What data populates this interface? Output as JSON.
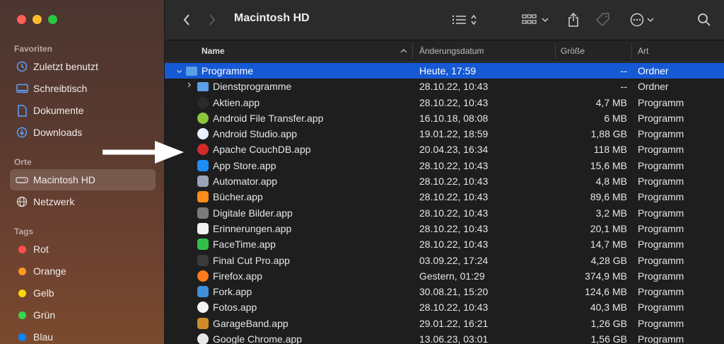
{
  "window": {
    "title": "Macintosh HD"
  },
  "colors": {
    "accent": "#1659d4",
    "sidebar": "#5a3a30"
  },
  "sidebar": {
    "favorites_label": "Favoriten",
    "favorites": [
      {
        "label": "Zuletzt benutzt",
        "icon": "clock-icon"
      },
      {
        "label": "Schreibtisch",
        "icon": "desktop-icon"
      },
      {
        "label": "Dokumente",
        "icon": "document-icon"
      },
      {
        "label": "Downloads",
        "icon": "download-icon"
      }
    ],
    "locations_label": "Orte",
    "locations": [
      {
        "label": "Macintosh HD",
        "icon": "harddisk-icon",
        "selected": true
      },
      {
        "label": "Netzwerk",
        "icon": "globe-icon"
      }
    ],
    "tags_label": "Tags",
    "tags": [
      {
        "label": "Rot",
        "color": "#fe4f4f"
      },
      {
        "label": "Orange",
        "color": "#ff9a1f"
      },
      {
        "label": "Gelb",
        "color": "#ffd60a"
      },
      {
        "label": "Grün",
        "color": "#32d74b"
      },
      {
        "label": "Blau",
        "color": "#0a84ff"
      }
    ]
  },
  "header": {
    "name": "Name",
    "date": "Änderungsdatum",
    "size": "Größe",
    "kind": "Art"
  },
  "rows": [
    {
      "name": "Programme",
      "date": "Heute, 17:59",
      "size": "--",
      "kind": "Ordner",
      "level": 0,
      "disclosure": "open",
      "icon": "folder-icon",
      "color": "#5aa0e6",
      "selected": true
    },
    {
      "name": "Dienstprogramme",
      "date": "28.10.22, 10:43",
      "size": "--",
      "kind": "Ordner",
      "level": 1,
      "disclosure": "closed",
      "icon": "folder-icon",
      "color": "#5aa0e6"
    },
    {
      "name": "Aktien.app",
      "date": "28.10.22, 10:43",
      "size": "4,7 MB",
      "kind": "Programm",
      "level": 1,
      "icon": "stocks-icon",
      "color": "#2b2b2b"
    },
    {
      "name": "Android File Transfer.app",
      "date": "16.10.18, 08:08",
      "size": "6 MB",
      "kind": "Programm",
      "level": 1,
      "icon": "android-icon",
      "color": "#8cc63f"
    },
    {
      "name": "Android Studio.app",
      "date": "19.01.22, 18:59",
      "size": "1,88 GB",
      "kind": "Programm",
      "level": 1,
      "icon": "android-studio-icon",
      "color": "#e8f0ff"
    },
    {
      "name": "Apache CouchDB.app",
      "date": "20.04.23, 16:34",
      "size": "118 MB",
      "kind": "Programm",
      "level": 1,
      "icon": "couchdb-icon",
      "color": "#d42a2a"
    },
    {
      "name": "App Store.app",
      "date": "28.10.22, 10:43",
      "size": "15,6 MB",
      "kind": "Programm",
      "level": 1,
      "icon": "appstore-icon",
      "color": "#1e8cf5"
    },
    {
      "name": "Automator.app",
      "date": "28.10.22, 10:43",
      "size": "4,8 MB",
      "kind": "Programm",
      "level": 1,
      "icon": "automator-icon",
      "color": "#9aa4b8"
    },
    {
      "name": "Bücher.app",
      "date": "28.10.22, 10:43",
      "size": "89,6 MB",
      "kind": "Programm",
      "level": 1,
      "icon": "books-icon",
      "color": "#ff8c1a"
    },
    {
      "name": "Digitale Bilder.app",
      "date": "28.10.22, 10:43",
      "size": "3,2 MB",
      "kind": "Programm",
      "level": 1,
      "icon": "camera-icon",
      "color": "#7a7a7a"
    },
    {
      "name": "Erinnerungen.app",
      "date": "28.10.22, 10:43",
      "size": "20,1 MB",
      "kind": "Programm",
      "level": 1,
      "icon": "reminders-icon",
      "color": "#f2f2f2"
    },
    {
      "name": "FaceTime.app",
      "date": "28.10.22, 10:43",
      "size": "14,7 MB",
      "kind": "Programm",
      "level": 1,
      "icon": "facetime-icon",
      "color": "#30c048"
    },
    {
      "name": "Final Cut Pro.app",
      "date": "03.09.22, 17:24",
      "size": "4,28 GB",
      "kind": "Programm",
      "level": 1,
      "icon": "finalcut-icon",
      "color": "#3a3a3a"
    },
    {
      "name": "Firefox.app",
      "date": "Gestern, 01:29",
      "size": "374,9 MB",
      "kind": "Programm",
      "level": 1,
      "icon": "firefox-icon",
      "color": "#ff7a1a"
    },
    {
      "name": "Fork.app",
      "date": "30.08.21, 15:20",
      "size": "124,6 MB",
      "kind": "Programm",
      "level": 1,
      "icon": "fork-icon",
      "color": "#3f8ed8"
    },
    {
      "name": "Fotos.app",
      "date": "28.10.22, 10:43",
      "size": "40,3 MB",
      "kind": "Programm",
      "level": 1,
      "icon": "photos-icon",
      "color": "#f4f4f4"
    },
    {
      "name": "GarageBand.app",
      "date": "29.01.22, 16:21",
      "size": "1,26 GB",
      "kind": "Programm",
      "level": 1,
      "icon": "garageband-icon",
      "color": "#d08a2a"
    },
    {
      "name": "Google Chrome.app",
      "date": "13.06.23, 03:01",
      "size": "1,56 GB",
      "kind": "Programm",
      "level": 1,
      "icon": "chrome-icon",
      "color": "#e8e8e8"
    }
  ]
}
